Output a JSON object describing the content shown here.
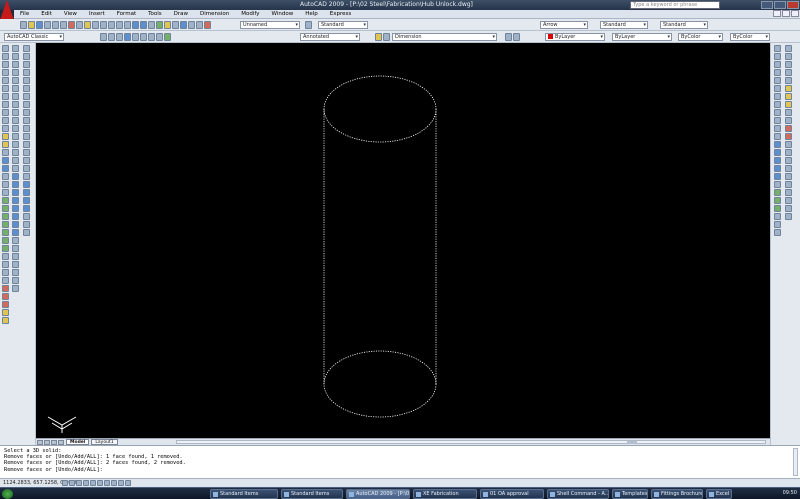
{
  "window": {
    "title": "AutoCAD 2009 - [P:\\02 Steel\\Fabrication\\Hub Unlock.dwg]",
    "help_search_placeholder": "Type a keyword or phrase"
  },
  "menu": [
    "File",
    "Edit",
    "View",
    "Insert",
    "Format",
    "Tools",
    "Draw",
    "Dimension",
    "Modify",
    "Window",
    "Help",
    "Express"
  ],
  "toolbar1": {
    "workspace": "AutoCAD Classic",
    "text_style": "Standard",
    "dim_style": "Arrow",
    "table_style": "Standard",
    "multileader_style": "Standard",
    "unnamed_view": "Unnamed"
  },
  "toolbar2": {
    "layer_state": "Annotated",
    "layer_name": "Dimension",
    "color": "ByLayer",
    "linetype": "ByLayer",
    "lineweight": "ByColor",
    "plot_style": "ByColor"
  },
  "tabs": [
    "Model",
    "Layout1"
  ],
  "command_history": [
    "Select a 3D solid:",
    "Remove faces or [Undo/Add/ALL]: 1 face found, 1 removed.",
    "Remove faces or [Undo/Add/ALL]: 2 faces found, 2 removed.",
    "Remove faces or [Undo/Add/ALL]:"
  ],
  "status": {
    "coordinates": "1124.2833, 657.1258, 0.0000"
  },
  "taskbar": {
    "items": [
      "Standard Items",
      "Standard Items",
      "AutoCAD 2009 - [P:\\02 St...",
      "XE Fabrication",
      "01 OA approval",
      "Shell Command - A...",
      "Templates",
      "Fittings Brochures",
      "Excel"
    ],
    "active_index": 2,
    "clock": "09:50"
  },
  "colors": {
    "canvas": "#000000",
    "wireframe": "#ffffff",
    "logo": "#c41a1a"
  }
}
